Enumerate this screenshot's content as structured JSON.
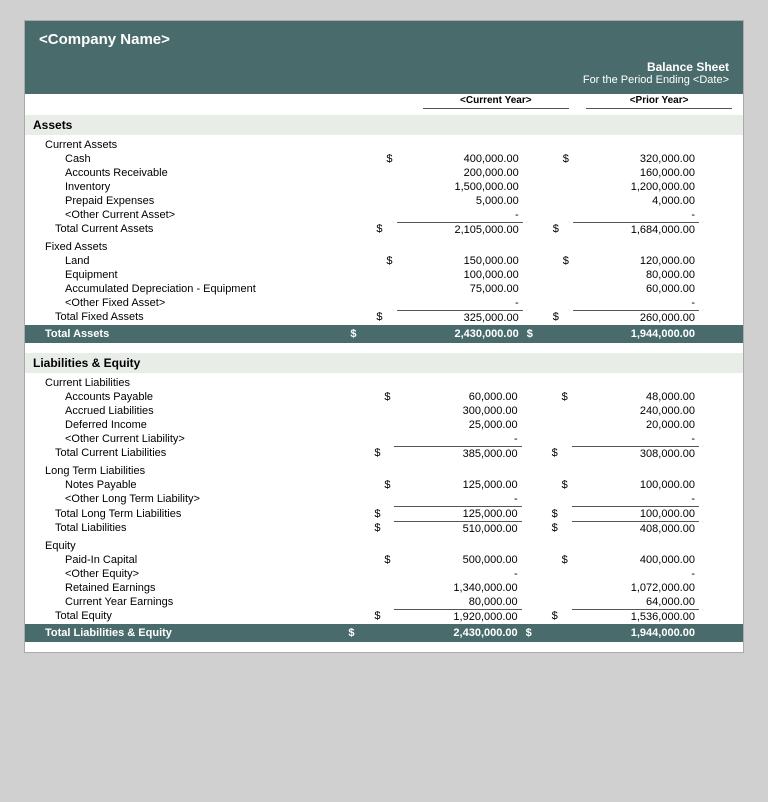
{
  "header": {
    "company": "<Company Name>",
    "title": "Balance Sheet",
    "period": "For the Period Ending <Date>",
    "col_current": "<Current Year>",
    "col_prior": "<Prior Year>"
  },
  "sections": [
    {
      "id": "assets",
      "label": "Assets",
      "subsections": [
        {
          "label": "Current Assets",
          "rows": [
            {
              "name": "Cash",
              "sign1": "$",
              "cy": "400,000.00",
              "sign2": "$",
              "py": "320,000.00"
            },
            {
              "name": "Accounts Receivable",
              "sign1": "",
              "cy": "200,000.00",
              "sign2": "",
              "py": "160,000.00"
            },
            {
              "name": "Inventory",
              "sign1": "",
              "cy": "1,500,000.00",
              "sign2": "",
              "py": "1,200,000.00"
            },
            {
              "name": "Prepaid Expenses",
              "sign1": "",
              "cy": "5,000.00",
              "sign2": "",
              "py": "4,000.00"
            },
            {
              "name": "<Other Current Asset>",
              "sign1": "",
              "cy": "-",
              "sign2": "",
              "py": "-"
            }
          ],
          "total": {
            "label": "Total Current Assets",
            "sign1": "$",
            "cy": "2,105,000.00",
            "sign2": "$",
            "py": "1,684,000.00"
          }
        },
        {
          "label": "Fixed Assets",
          "rows": [
            {
              "name": "Land",
              "sign1": "$",
              "cy": "150,000.00",
              "sign2": "$",
              "py": "120,000.00"
            },
            {
              "name": "Equipment",
              "sign1": "",
              "cy": "100,000.00",
              "sign2": "",
              "py": "80,000.00"
            },
            {
              "name": "Accumulated Depreciation - Equipment",
              "sign1": "",
              "cy": "75,000.00",
              "sign2": "",
              "py": "60,000.00"
            },
            {
              "name": "<Other Fixed Asset>",
              "sign1": "",
              "cy": "-",
              "sign2": "",
              "py": "-"
            }
          ],
          "total": {
            "label": "Total Fixed Assets",
            "sign1": "$",
            "cy": "325,000.00",
            "sign2": "$",
            "py": "260,000.00"
          }
        }
      ],
      "grand_total": {
        "label": "Total Assets",
        "sign1": "$",
        "cy": "2,430,000.00",
        "sign2": "$",
        "py": "1,944,000.00"
      }
    },
    {
      "id": "liabilities",
      "label": "Liabilities & Equity",
      "subsections": [
        {
          "label": "Current Liabilities",
          "rows": [
            {
              "name": "Accounts Payable",
              "sign1": "$",
              "cy": "60,000.00",
              "sign2": "$",
              "py": "48,000.00"
            },
            {
              "name": "Accrued Liabilities",
              "sign1": "",
              "cy": "300,000.00",
              "sign2": "",
              "py": "240,000.00"
            },
            {
              "name": "Deferred Income",
              "sign1": "",
              "cy": "25,000.00",
              "sign2": "",
              "py": "20,000.00"
            },
            {
              "name": "<Other Current Liability>",
              "sign1": "",
              "cy": "-",
              "sign2": "",
              "py": "-"
            }
          ],
          "total": {
            "label": "Total Current Liabilities",
            "sign1": "$",
            "cy": "385,000.00",
            "sign2": "$",
            "py": "308,000.00"
          }
        },
        {
          "label": "Long Term Liabilities",
          "rows": [
            {
              "name": "Notes Payable",
              "sign1": "$",
              "cy": "125,000.00",
              "sign2": "$",
              "py": "100,000.00"
            },
            {
              "name": "<Other Long Term Liability>",
              "sign1": "",
              "cy": "-",
              "sign2": "",
              "py": "-"
            }
          ],
          "total_lt": {
            "label": "Total Long Term Liabilities",
            "sign1": "$",
            "cy": "125,000.00",
            "sign2": "$",
            "py": "100,000.00"
          },
          "total_all": {
            "label": "Total Liabilities",
            "sign1": "$",
            "cy": "510,000.00",
            "sign2": "$",
            "py": "408,000.00"
          }
        },
        {
          "label": "Equity",
          "rows": [
            {
              "name": "Paid-In Capital",
              "sign1": "$",
              "cy": "500,000.00",
              "sign2": "$",
              "py": "400,000.00"
            },
            {
              "name": "<Other Equity>",
              "sign1": "",
              "cy": "-",
              "sign2": "",
              "py": "-"
            },
            {
              "name": "Retained Earnings",
              "sign1": "",
              "cy": "1,340,000.00",
              "sign2": "",
              "py": "1,072,000.00"
            },
            {
              "name": "Current Year Earnings",
              "sign1": "",
              "cy": "80,000.00",
              "sign2": "",
              "py": "64,000.00"
            }
          ],
          "total": {
            "label": "Total Equity",
            "sign1": "$",
            "cy": "1,920,000.00",
            "sign2": "$",
            "py": "1,536,000.00"
          }
        }
      ],
      "grand_total": {
        "label": "Total Liabilities & Equity",
        "sign1": "$",
        "cy": "2,430,000.00",
        "sign2": "$",
        "py": "1,944,000.00"
      }
    }
  ]
}
